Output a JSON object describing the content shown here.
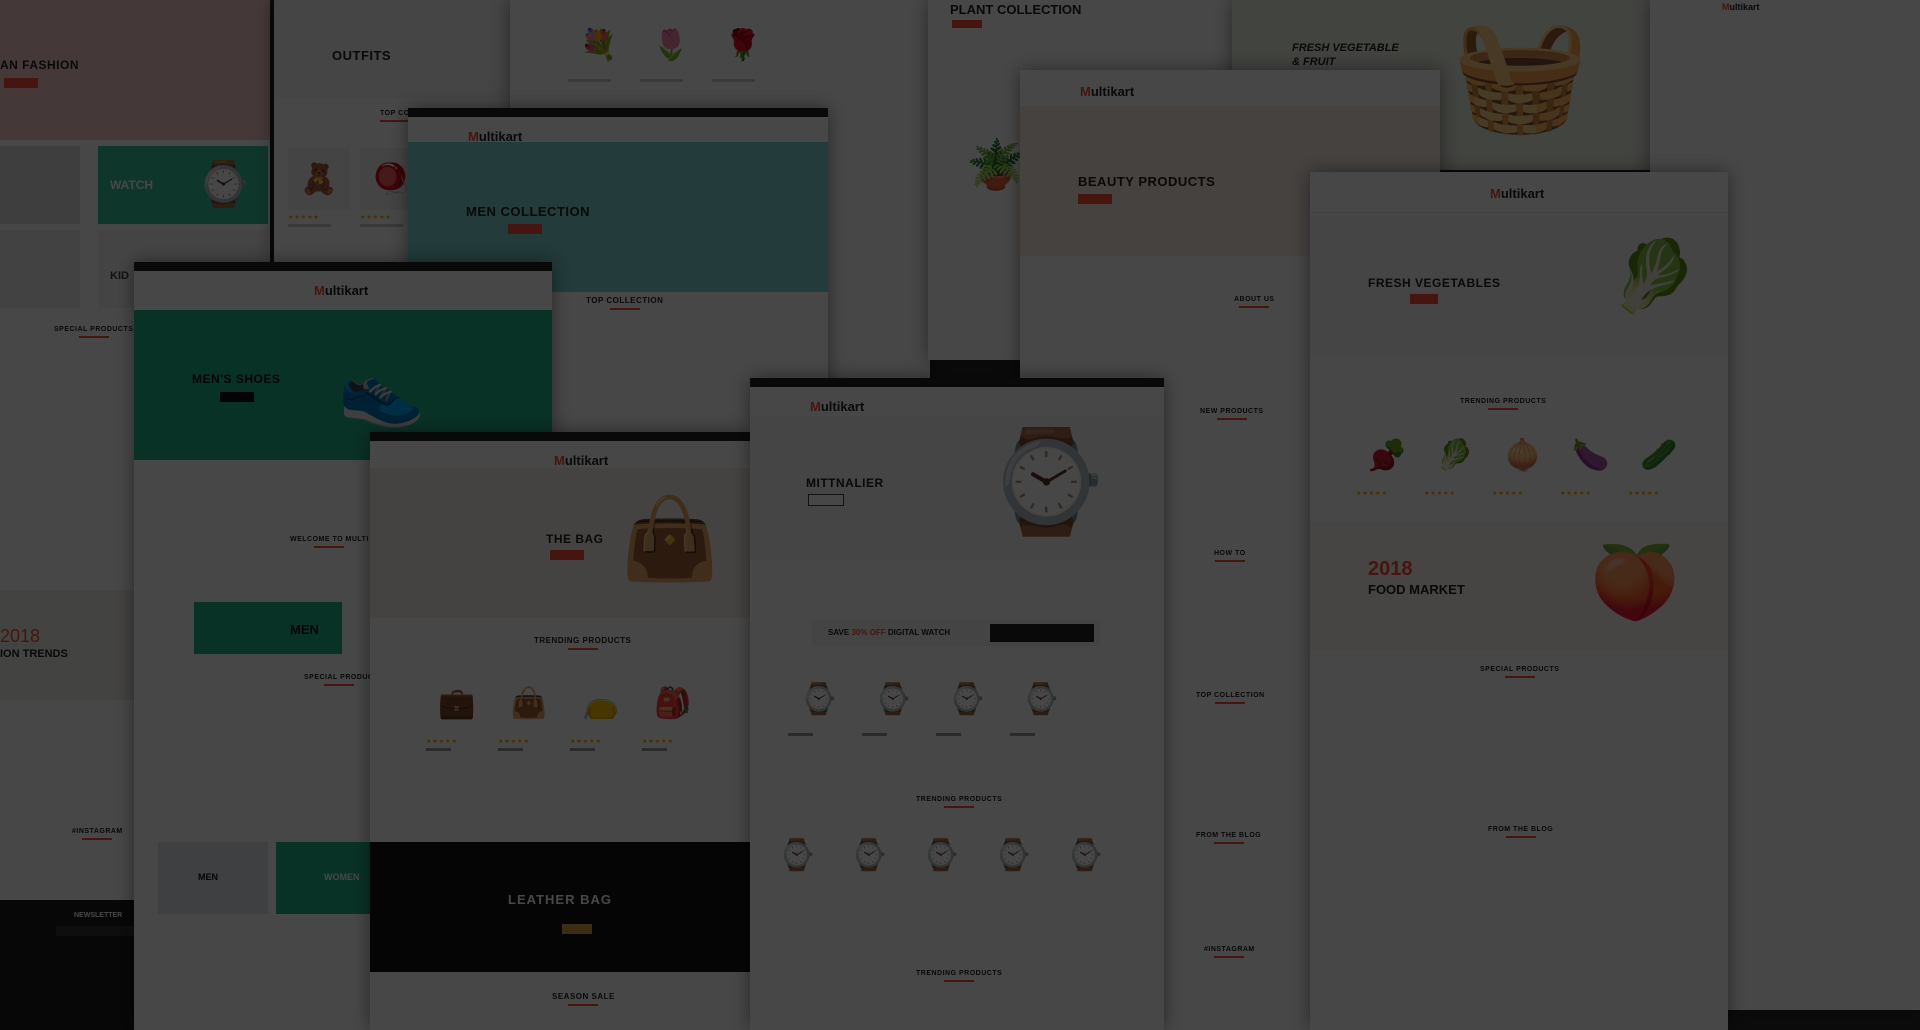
{
  "brand": {
    "logo_prefix": "M",
    "logo_rest": "ultikart",
    "accent": "#ff4c3b"
  },
  "screens": {
    "fashion": {
      "hero": "AN FASHION",
      "tile_watch": "WATCH",
      "tile_kids": "KID",
      "special": "SPECIAL PRODUCTS",
      "trends_year": "2018",
      "trends": "ION TRENDS",
      "instagram": "#INSTAGRAM",
      "newsletter": "NEWSLETTER"
    },
    "kids": {
      "hero": "OUTFITS",
      "section": "TOP CO"
    },
    "flowers": {
      "plant": "PLANT COLLECTION"
    },
    "vegetable": {
      "hero_line1": "FRESH VEGETABLE",
      "hero_line2": "& FRUIT"
    },
    "men": {
      "hero": "MEN COLLECTION",
      "section": "TOP COLLECTION"
    },
    "shoes": {
      "hero": "MEN'S SHOES",
      "welcome": "WELCOME TO MULTI",
      "tile_men": "MEN",
      "special": "SPECIAL PRODUC",
      "tile_men2": "MEN",
      "tile_women": "WOMEN"
    },
    "bag": {
      "hero": "THE BAG",
      "trending": "TRENDING PRODUCTS",
      "banner": "LEATHER BAG",
      "season": "SEASON SALE"
    },
    "watch": {
      "hero": "MITTNALIER",
      "sale_pre": "SAVE",
      "sale_pct": "30% OFF",
      "sale_post": "DIGITAL WATCH",
      "trending1": "TRENDING PRODUCTS",
      "trending2": "TRENDING PRODUCTS"
    },
    "beauty": {
      "hero": "BEAUTY PRODUCTS",
      "about": "ABOUT US",
      "new_products": "NEW PRODUCTS",
      "howto": "HOW TO",
      "top": "TOP COLLECTION",
      "blog": "FROM THE BLOG",
      "instagram": "#INSTAGRAM"
    },
    "grocery": {
      "hero": "FRESH VEGETABLES",
      "trending": "TRENDING PRODUCTS",
      "year": "2018",
      "market": "FOOD MARKET",
      "special": "SPECIAL PRODUCTS",
      "blog": "FROM THE BLOG"
    }
  }
}
